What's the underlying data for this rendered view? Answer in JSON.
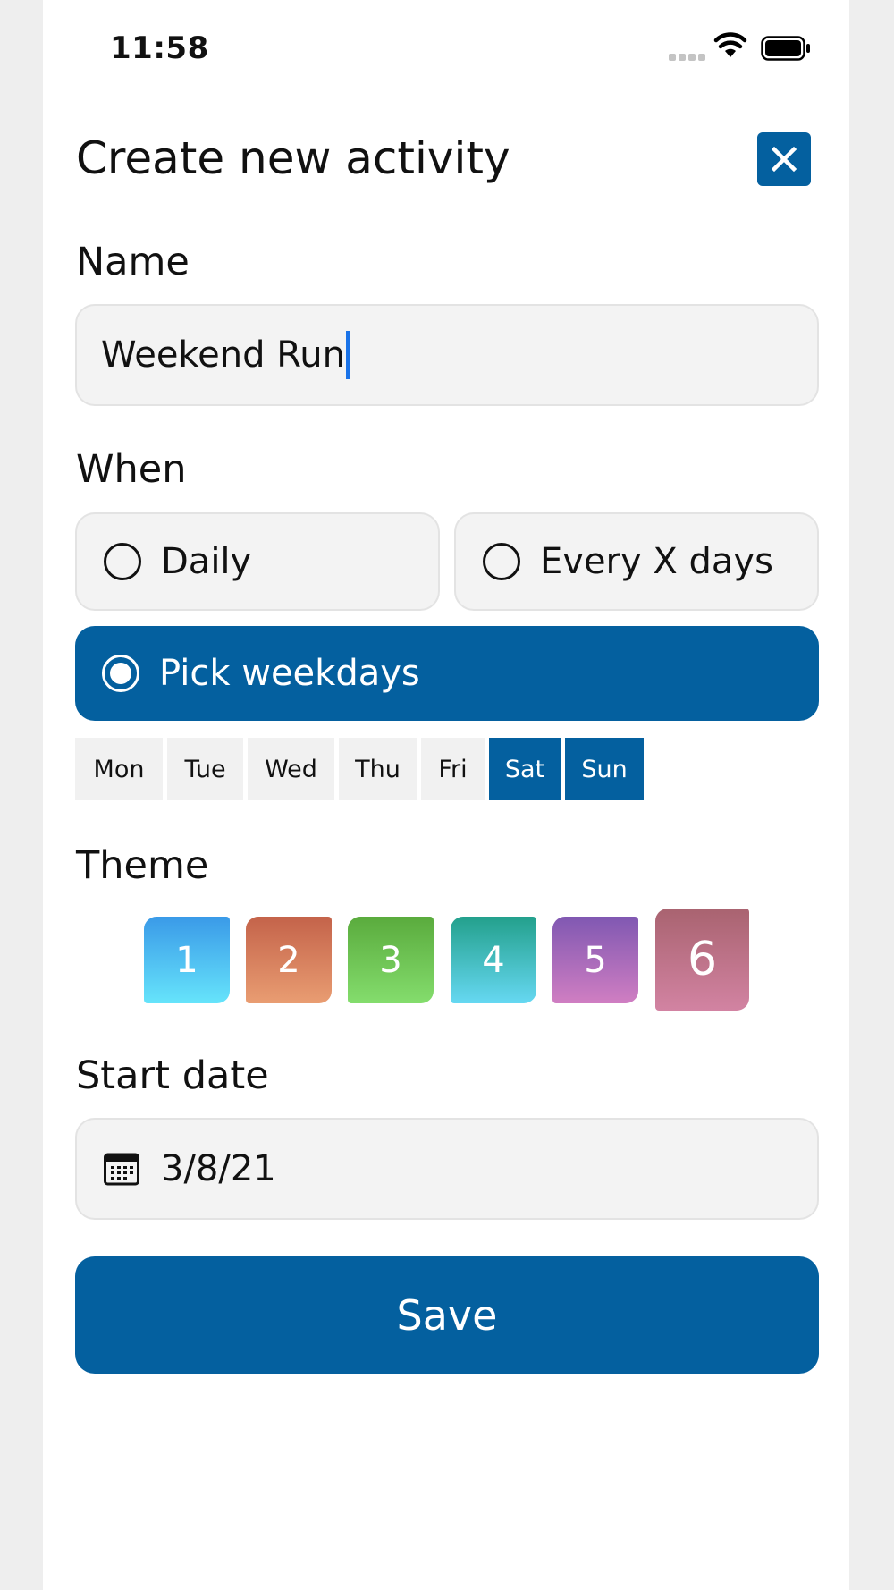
{
  "status_bar": {
    "time": "11:58"
  },
  "header": {
    "title": "Create new activity",
    "close_icon": "close-icon"
  },
  "name": {
    "label": "Name",
    "value": "Weekend Run"
  },
  "when": {
    "label": "When",
    "options": [
      {
        "label": "Daily",
        "selected": false
      },
      {
        "label": "Every X days",
        "selected": false
      },
      {
        "label": "Pick weekdays",
        "selected": true
      }
    ],
    "days": [
      {
        "label": "Mon",
        "selected": false
      },
      {
        "label": "Tue",
        "selected": false
      },
      {
        "label": "Wed",
        "selected": false
      },
      {
        "label": "Thu",
        "selected": false
      },
      {
        "label": "Fri",
        "selected": false
      },
      {
        "label": "Sat",
        "selected": true
      },
      {
        "label": "Sun",
        "selected": true
      }
    ]
  },
  "theme": {
    "label": "Theme",
    "options": [
      {
        "label": "1",
        "gradient": [
          "#3a9ae8",
          "#66e4fb"
        ]
      },
      {
        "label": "2",
        "gradient": [
          "#c4634a",
          "#e99d72"
        ]
      },
      {
        "label": "3",
        "gradient": [
          "#5aab3d",
          "#84dd6d"
        ]
      },
      {
        "label": "4",
        "gradient": [
          "#23a08c",
          "#66d8f2"
        ]
      },
      {
        "label": "5",
        "gradient": [
          "#8058b2",
          "#d07ec2"
        ]
      },
      {
        "label": "6",
        "gradient": [
          "#a96370",
          "#d283a2"
        ],
        "selected": true
      }
    ]
  },
  "start_date": {
    "label": "Start date",
    "value": "3/8/21",
    "icon": "calendar-icon"
  },
  "save": {
    "label": "Save"
  },
  "colors": {
    "accent": "#04609f",
    "field_bg": "#f3f3f3"
  }
}
